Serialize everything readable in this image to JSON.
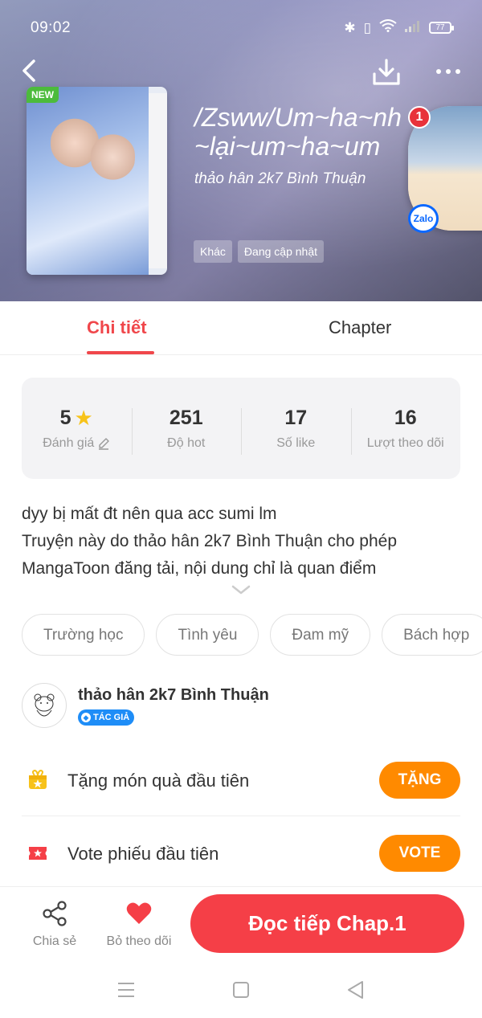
{
  "status_bar": {
    "time": "09:02",
    "battery": "77"
  },
  "header": {
    "new_badge": "NEW",
    "title": "/Zsww/Um~ha~nh\n~lại~um~ha~um",
    "author": "thảo hân 2k7 Bình Thuận",
    "tags": [
      "Khác",
      "Đang cập nhật"
    ]
  },
  "zalo": {
    "badge_count": "1",
    "logo_text": "Zalo"
  },
  "tabs": {
    "detail": "Chi tiết",
    "chapter": "Chapter"
  },
  "stats": {
    "rating_value": "5",
    "rating_label": "Đánh giá",
    "hot_value": "251",
    "hot_label": "Độ hot",
    "likes_value": "17",
    "likes_label": "Số like",
    "followers_value": "16",
    "followers_label": "Lượt theo dõi"
  },
  "description": {
    "line1": "dyy bị mất đt nên qua acc sumi lm",
    "line2": "Truyện này do thảo hân 2k7 Bình Thuận cho phép",
    "line3": "MangaToon đăng tải, nội dung chỉ là quan điểm"
  },
  "genres": [
    "Trường học",
    "Tình yêu",
    "Đam mỹ",
    "Bách hợp"
  ],
  "author_section": {
    "name": "thảo hân 2k7 Bình Thuận",
    "badge": "TÁC GIẢ"
  },
  "actions": {
    "gift_label": "Tặng món quà đầu tiên",
    "gift_button": "TẶNG",
    "vote_label": "Vote phiếu đầu tiên",
    "vote_button": "VOTE"
  },
  "bottom_bar": {
    "share_label": "Chia sẻ",
    "unfollow_label": "Bỏ theo dõi",
    "read_button": "Đọc tiếp Chap.1"
  },
  "colors": {
    "accent": "#f53f47",
    "orange": "#ff8a00",
    "new_badge": "#4cbb3c",
    "star": "#f7c31a"
  }
}
